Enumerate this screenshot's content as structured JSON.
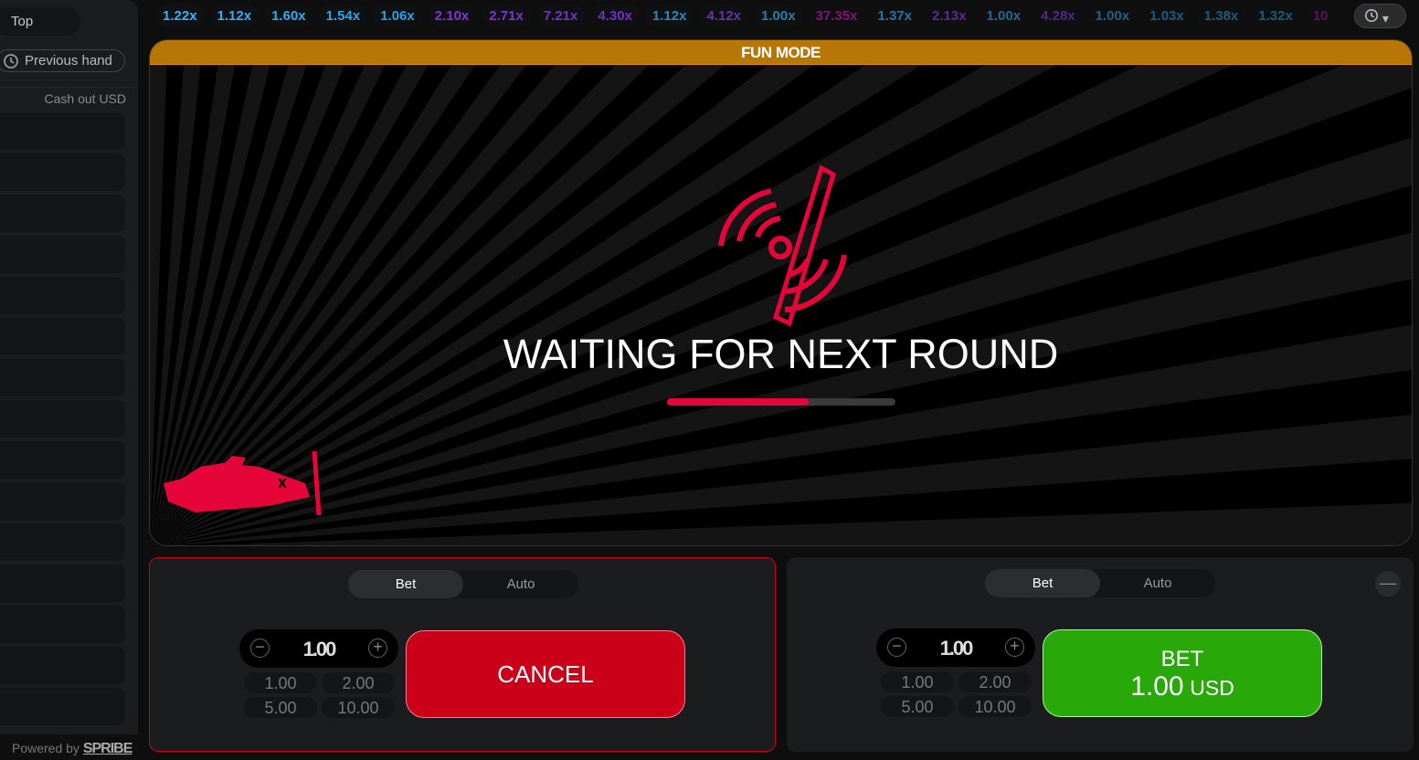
{
  "sidebar": {
    "top_tab": "Top",
    "previous_hand": "Previous hand",
    "cash_out_label": "Cash out USD",
    "row_count": 15,
    "powered_by": "Powered by",
    "brand": "SPRIBE"
  },
  "multipliers": [
    {
      "v": "1.22x",
      "c": "#34b4ff"
    },
    {
      "v": "1.12x",
      "c": "#34b4ff"
    },
    {
      "v": "1.60x",
      "c": "#34b4ff"
    },
    {
      "v": "1.54x",
      "c": "#34b4ff"
    },
    {
      "v": "1.06x",
      "c": "#34b4ff"
    },
    {
      "v": "2.10x",
      "c": "#913ef8"
    },
    {
      "v": "2.71x",
      "c": "#913ef8"
    },
    {
      "v": "7.21x",
      "c": "#913ef8"
    },
    {
      "v": "4.30x",
      "c": "#913ef8"
    },
    {
      "v": "1.12x",
      "c": "#34b4ff"
    },
    {
      "v": "4.12x",
      "c": "#913ef8"
    },
    {
      "v": "1.00x",
      "c": "#34b4ff"
    },
    {
      "v": "37.35x",
      "c": "#c017b4"
    },
    {
      "v": "1.37x",
      "c": "#34b4ff"
    },
    {
      "v": "2.13x",
      "c": "#913ef8"
    },
    {
      "v": "1.00x",
      "c": "#34b4ff"
    },
    {
      "v": "4.28x",
      "c": "#913ef8"
    },
    {
      "v": "1.00x",
      "c": "#34b4ff"
    },
    {
      "v": "1.03x",
      "c": "#34b4ff"
    },
    {
      "v": "1.38x",
      "c": "#34b4ff"
    },
    {
      "v": "1.32x",
      "c": "#34b4ff"
    },
    {
      "v": "10",
      "c": "#c017b4"
    }
  ],
  "history_icon": "history-icon",
  "game": {
    "mode_banner": "FUN MODE",
    "status": "WAITING FOR NEXT ROUND",
    "progress_percent": 62,
    "accent": "#e50539"
  },
  "bet_panels": [
    {
      "tabs": [
        "Bet",
        "Auto"
      ],
      "selected_tab": "Bet",
      "amount": "1.00",
      "quick": [
        "1.00",
        "2.00",
        "5.00",
        "10.00"
      ],
      "button": "CANCEL"
    },
    {
      "tabs": [
        "Bet",
        "Auto"
      ],
      "selected_tab": "Bet",
      "amount": "1.00",
      "quick": [
        "1.00",
        "2.00",
        "5.00",
        "10.00"
      ],
      "button": "BET",
      "button_amount": "1.00",
      "currency": "USD"
    }
  ]
}
